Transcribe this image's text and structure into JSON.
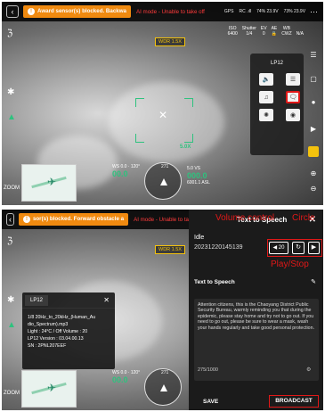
{
  "screen1": {
    "warning": "Award sensor(s) blocked. Backwa",
    "mode_text": "AI mode - Unable to take off",
    "status": {
      "signal": "RC .ıll",
      "battery1": "74% 23.9V",
      "battery2": "73% 23.9V",
      "gps": "GPS"
    },
    "wdr": "WDR 1.5X",
    "zoom_value": "5.0X",
    "camera": {
      "iso_label": "ISO",
      "iso": "6400",
      "shutter_label": "Shutter",
      "shutter": "1/4",
      "ev_label": "EV",
      "ev": "0",
      "ae_label": "AE",
      "ae": "🔒",
      "wb_label": "WB",
      "wb": "CWZ",
      "extra": "N/A"
    },
    "lp_title": "LP12",
    "telemetry": {
      "ws": "WS 0.0 · 120°",
      "hs": "00.0",
      "vs": "000.0",
      "dist": "5.0 VS",
      "alt": "6001.1 ASL",
      "heading": "271"
    },
    "zoom_label": "ZOOM"
  },
  "screen2": {
    "warning": "sor(s) blocked. Forward obstacle a",
    "mode_text": "AI mode - Unable to ta",
    "wdr": "WDR 1.5X",
    "panel_title": "Text to Speech",
    "status_idle": "Idle",
    "file_id": "20231220145139",
    "volume": "20",
    "annotations": {
      "volume": "Volume control",
      "circle": "Circle",
      "play": "Play/Stop"
    },
    "tts_label": "Text to Speech",
    "tts_text": "Attention citizens, this is the Chaoyang District Public Security Bureau, warmly reminding you that during the epidemic, please stay home and try not to go out. If you need to go out, please be sure to wear a mask, wash your hands regularly and take good personal protection.",
    "counter": "275/1000",
    "save_label": "SAVE",
    "broadcast_label": "BROADCAST",
    "info": {
      "title": "LP12",
      "line1": "1/8 20Hz_to_20kHz_(Human_Au",
      "line2": "dio_Spectrum).mp3",
      "line3": "Light : 24°C / Off   Volume : 20",
      "line4": "LP12 Version : 03.04.00.13",
      "line5": "SN : 2PNL207EEF"
    },
    "telemetry": {
      "ws": "WS 0.0 · 120°",
      "hs": "00.0",
      "heading": "271"
    },
    "zoom_label": "ZOOM"
  }
}
